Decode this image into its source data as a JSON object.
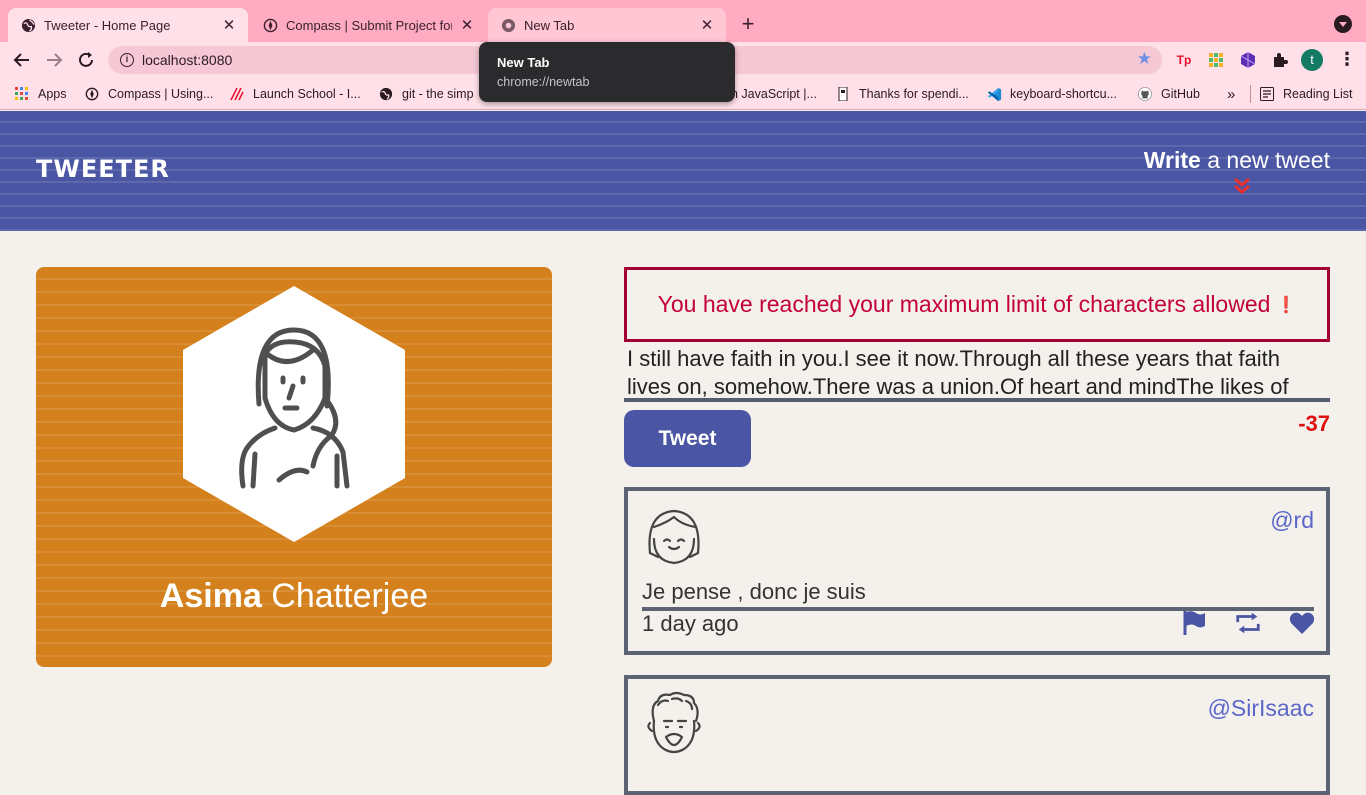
{
  "browser": {
    "tabs": [
      {
        "title": "Tweeter - Home Page",
        "state": "active"
      },
      {
        "title": "Compass | Submit Project for E",
        "state": "inactive"
      },
      {
        "title": "New Tab",
        "state": "hovered"
      }
    ],
    "new_tab_label": "+",
    "address": {
      "url": "localhost:8080"
    },
    "profile_initial": "t",
    "bookmarks": [
      {
        "label": "Apps",
        "icon": "apps-grid-icon"
      },
      {
        "label": "Compass | Using...",
        "icon": "compass-icon"
      },
      {
        "label": "Launch School - I...",
        "icon": "launch-school-icon"
      },
      {
        "label": "git - the simp",
        "icon": "globe-icon"
      },
      {
        "label": "h JavaScript |...",
        "icon": "js-icon"
      },
      {
        "label": "Thanks for spendi...",
        "icon": "bookmark-icon"
      },
      {
        "label": "keyboard-shortcu...",
        "icon": "vscode-icon"
      },
      {
        "label": "GitHub",
        "icon": "github-icon"
      }
    ],
    "bookmarks_overflow": "»",
    "reading_list": "Reading List",
    "tooltip": {
      "title": "New Tab",
      "url": "chrome://newtab"
    },
    "colors": {
      "tabstrip": "#ffabc1",
      "toolbar": "#ffe0e8"
    }
  },
  "app": {
    "brand": "TWEETER",
    "write_link": {
      "bold": "Write",
      "rest": " a new tweet"
    },
    "profile": {
      "first_name": "Asima",
      "last_name": " Chatterjee"
    },
    "error_message": "You have reached your maximum limit of characters allowed",
    "error_mark": "❗",
    "tweet_input_value": "I still have faith in you.I see it now.Through all these years that faith lives on, somehow.There was a union.Of heart and mindThe likes of which are",
    "tweet_button": "Tweet",
    "char_counter": "-37",
    "tweets": [
      {
        "handle": "@rd",
        "content": "Je pense , donc je suis",
        "timestamp": "1 day ago"
      },
      {
        "handle": "@SirIsaac",
        "content": "",
        "timestamp": ""
      }
    ],
    "colors": {
      "nav": "#4a55a3",
      "profile_card": "#d4811d",
      "error": "#c4003c",
      "counter": "#e01010",
      "accent": "#4a55a3"
    }
  }
}
